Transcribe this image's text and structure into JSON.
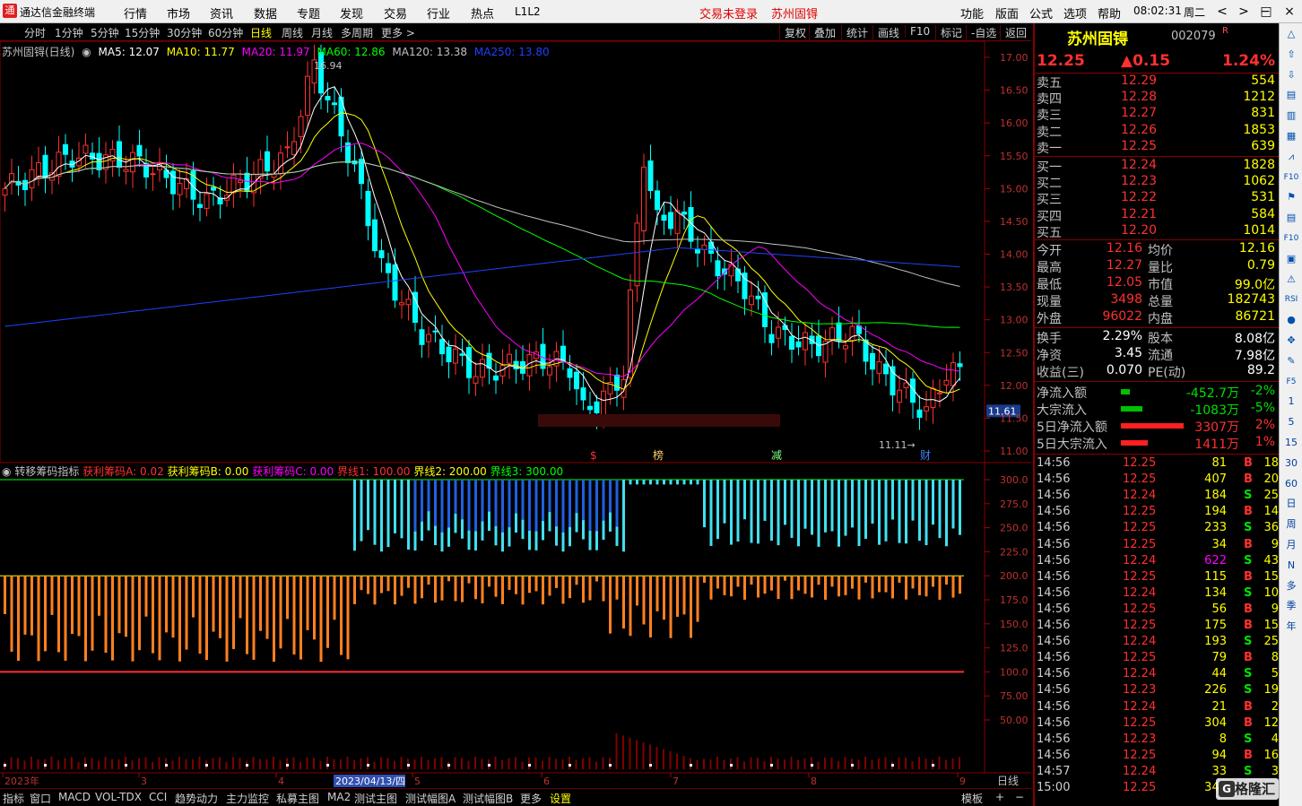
{
  "app": {
    "title": "通达信金融终端",
    "menu": [
      "行情",
      "市场",
      "资讯",
      "数据",
      "专题",
      "发现",
      "交易",
      "行业",
      "热点",
      "L1L2"
    ],
    "status": [
      "交易未登录",
      "苏州固锝"
    ],
    "right_menu": [
      "功能",
      "版面",
      "公式",
      "选项",
      "帮助"
    ],
    "clock": "08:02:31",
    "weekday": "周二",
    "window_buttons": [
      "<",
      ">",
      "−",
      "□",
      "×"
    ]
  },
  "periods": [
    "分时",
    "1分钟",
    "5分钟",
    "15分钟",
    "30分钟",
    "60分钟",
    "日线",
    "周线",
    "月线",
    "多周期",
    "更多 >"
  ],
  "active_period": "日线",
  "chart_tools": [
    "复权",
    "叠加",
    "统计",
    "画线",
    "F10",
    "标记",
    "-自选",
    "返回"
  ],
  "legend": {
    "name": "苏州固锝(日线)",
    "ma5": "MA5: 12.07",
    "ma10": "MA10: 11.77",
    "ma20": "MA20: 11.97",
    "ma60": "MA60: 12.86",
    "ma120": "MA120: 13.38",
    "ma250": "MA250: 13.80"
  },
  "colors": {
    "ma5": "#ffffff",
    "ma10": "#ffff00",
    "ma20": "#ff00ff",
    "ma60": "#00ff00",
    "ma120": "#c0c0c0",
    "ma250": "#2040ff",
    "up": "#ff3030",
    "down": "#00ffff"
  },
  "price_axis": [
    "17.00",
    "16.50",
    "16.00",
    "15.50",
    "15.00",
    "14.50",
    "14.00",
    "13.50",
    "13.00",
    "12.50",
    "12.00",
    "11.61",
    "11.50",
    "11.00"
  ],
  "marks": {
    "high": "16.94",
    "low": "11.11"
  },
  "event_markers": [
    "$",
    "榜",
    "减",
    "财"
  ],
  "indicator": {
    "name": "转移筹码指标",
    "a": "获利筹码A: 0.02",
    "b": "获利筹码B: 0.00",
    "c": "获利筹码C: 0.00",
    "l1": "界线1: 100.00",
    "l2": "界线2: 200.00",
    "l3": "界线3: 300.00"
  },
  "ind_axis": [
    "300.0",
    "275.0",
    "250.0",
    "225.0",
    "200.0",
    "175.0",
    "150.0",
    "125.0",
    "100.0",
    "75.00",
    "50.00"
  ],
  "date_axis": [
    "2023年",
    "3",
    "4",
    "2023/04/13/四",
    "5",
    "6",
    "7",
    "8",
    "9"
  ],
  "date_axis_right": "日线",
  "bottom_tabs": [
    "指标",
    "窗口",
    "MACD",
    "VOL-TDX",
    "CCI",
    "趋势动力",
    "主力监控",
    "私募主图",
    "MA2",
    "测试主图",
    "测试幅图A",
    "测试幅图B",
    "更多",
    "设置"
  ],
  "bottom_right": [
    "模板",
    "+",
    "−"
  ],
  "quote": {
    "name": "苏州固锝",
    "code": "002079",
    "flag": "R",
    "price": "12.25",
    "change": "▲0.15",
    "pct": "1.24%",
    "asks": [
      {
        "l": "卖五",
        "p": "12.29",
        "v": "554"
      },
      {
        "l": "卖四",
        "p": "12.28",
        "v": "1212"
      },
      {
        "l": "卖三",
        "p": "12.27",
        "v": "831"
      },
      {
        "l": "卖二",
        "p": "12.26",
        "v": "1853"
      },
      {
        "l": "卖一",
        "p": "12.25",
        "v": "639"
      }
    ],
    "bids": [
      {
        "l": "买一",
        "p": "12.24",
        "v": "1828"
      },
      {
        "l": "买二",
        "p": "12.23",
        "v": "1062"
      },
      {
        "l": "买三",
        "p": "12.22",
        "v": "531"
      },
      {
        "l": "买四",
        "p": "12.21",
        "v": "584"
      },
      {
        "l": "买五",
        "p": "12.20",
        "v": "1014"
      }
    ],
    "stats": [
      {
        "a": "今开",
        "b": "12.16",
        "c": "均价",
        "d": "12.16"
      },
      {
        "a": "最高",
        "b": "12.27",
        "c": "量比",
        "d": "0.79"
      },
      {
        "a": "最低",
        "b": "12.05",
        "c": "市值",
        "d": "99.0亿"
      },
      {
        "a": "现量",
        "b": "3498",
        "c": "总量",
        "d": "182743"
      },
      {
        "a": "外盘",
        "b": "96022",
        "c": "内盘",
        "d": "86721"
      }
    ],
    "stats2": [
      {
        "a": "换手",
        "b": "2.29%",
        "c": "股本",
        "d": "8.08亿"
      },
      {
        "a": "净资",
        "b": "3.45",
        "c": "流通",
        "d": "7.98亿"
      },
      {
        "a": "收益(三)",
        "b": "0.070",
        "c": "PE(动)",
        "d": "89.2"
      }
    ],
    "flows": [
      {
        "a": "净流入额",
        "b": "-452.7万",
        "c": "-2%"
      },
      {
        "a": "大宗流入",
        "b": "-1083万",
        "c": "-5%"
      },
      {
        "a": "5日净流入额",
        "b": "3307万",
        "c": "2%"
      },
      {
        "a": "5日大宗流入",
        "b": "1411万",
        "c": "1%"
      }
    ]
  },
  "ticks": [
    {
      "t": "14:56",
      "p": "12.25",
      "q": "81",
      "d": "B",
      "n": "18"
    },
    {
      "t": "14:56",
      "p": "12.25",
      "q": "407",
      "d": "B",
      "n": "20"
    },
    {
      "t": "14:56",
      "p": "12.24",
      "q": "184",
      "d": "S",
      "n": "25"
    },
    {
      "t": "14:56",
      "p": "12.25",
      "q": "194",
      "d": "B",
      "n": "14"
    },
    {
      "t": "14:56",
      "p": "12.25",
      "q": "233",
      "d": "S",
      "n": "36"
    },
    {
      "t": "14:56",
      "p": "12.25",
      "q": "34",
      "d": "B",
      "n": "9"
    },
    {
      "t": "14:56",
      "p": "12.24",
      "q": "622",
      "d": "S",
      "n": "43"
    },
    {
      "t": "14:56",
      "p": "12.25",
      "q": "115",
      "d": "B",
      "n": "15"
    },
    {
      "t": "14:56",
      "p": "12.24",
      "q": "134",
      "d": "S",
      "n": "10"
    },
    {
      "t": "14:56",
      "p": "12.25",
      "q": "56",
      "d": "B",
      "n": "9"
    },
    {
      "t": "14:56",
      "p": "12.25",
      "q": "175",
      "d": "B",
      "n": "15"
    },
    {
      "t": "14:56",
      "p": "12.24",
      "q": "193",
      "d": "S",
      "n": "25"
    },
    {
      "t": "14:56",
      "p": "12.25",
      "q": "79",
      "d": "B",
      "n": "8"
    },
    {
      "t": "14:56",
      "p": "12.24",
      "q": "44",
      "d": "S",
      "n": "5"
    },
    {
      "t": "14:56",
      "p": "12.23",
      "q": "226",
      "d": "S",
      "n": "19"
    },
    {
      "t": "14:56",
      "p": "12.24",
      "q": "21",
      "d": "B",
      "n": "2"
    },
    {
      "t": "14:56",
      "p": "12.25",
      "q": "304",
      "d": "B",
      "n": "12"
    },
    {
      "t": "14:56",
      "p": "12.23",
      "q": "8",
      "d": "S",
      "n": "4"
    },
    {
      "t": "14:56",
      "p": "12.25",
      "q": "94",
      "d": "B",
      "n": "16"
    },
    {
      "t": "14:57",
      "p": "12.24",
      "q": "33",
      "d": "S",
      "n": "3"
    },
    {
      "t": "15:00",
      "p": "12.25",
      "q": "349",
      "d": "",
      "n": ""
    }
  ],
  "sidebar_icons": [
    "up-arrow-icon",
    "up-hollow-icon",
    "down-hollow-icon",
    "grid-icon",
    "grid2-icon",
    "chart-icon",
    "chart2-icon",
    "f10-icon",
    "flag-icon",
    "grid3-icon",
    "f10b-icon",
    "buy-icon",
    "alert-icon",
    "rsi-icon",
    "red-icon",
    "move-icon",
    "pen-icon",
    "f5-icon",
    "1",
    "5",
    "15",
    "30",
    "60",
    "日",
    "周",
    "月",
    "N",
    "多",
    "季",
    "年"
  ],
  "sidebar_labels": [
    "",
    "",
    "",
    "",
    "",
    "",
    "",
    "F10",
    "",
    "",
    "F10",
    "",
    "",
    "RSI",
    "",
    "",
    "",
    "F5",
    "1",
    "5",
    "15",
    "30",
    "60",
    "日",
    "周",
    "月",
    "N",
    "多",
    "季",
    "年"
  ],
  "watermark": "格隆汇"
}
